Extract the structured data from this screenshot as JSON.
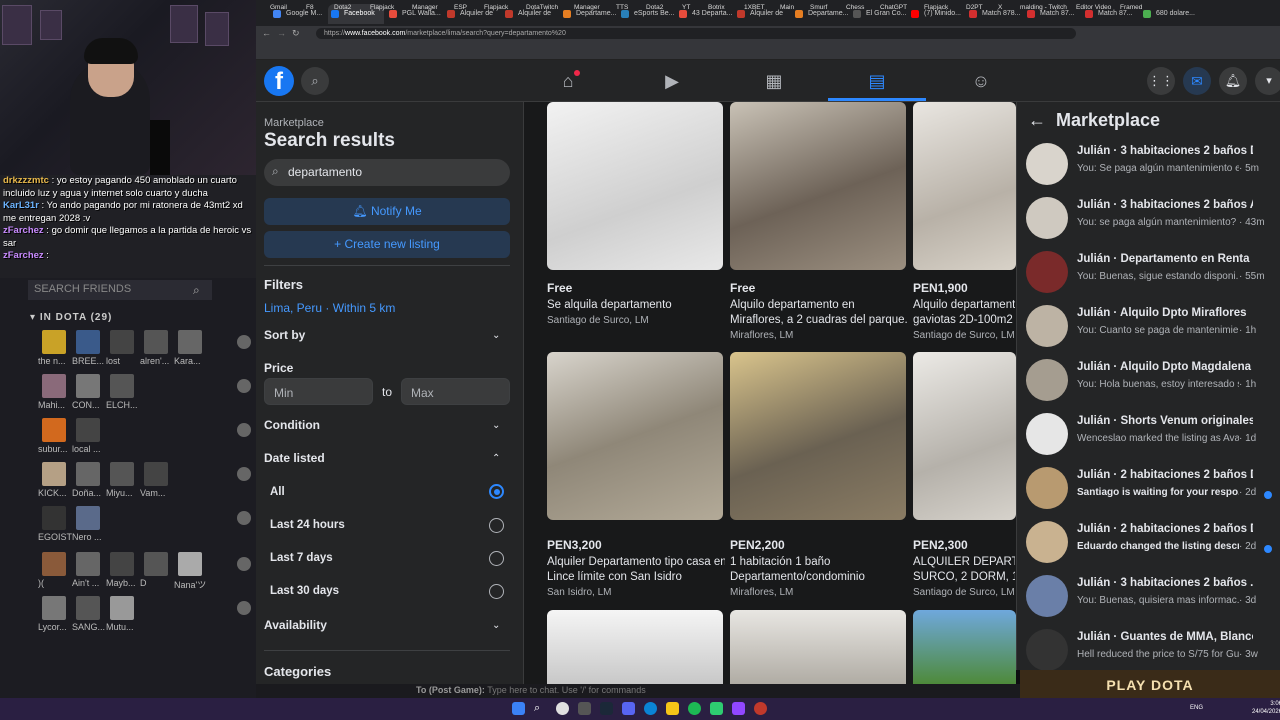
{
  "stream": {
    "chat": [
      {
        "user": "drkzzzmtc",
        "text": " : yo estoy pagando 450 amoblado un cuarto incluido luz y agua y internet solo cuarto y ducha",
        "color": "#e8b84a"
      },
      {
        "user": "KarL31r",
        "text": " : Yo ando pagando por mi ratonera de 43mt2 xd me entregan 2028 :v",
        "color": "#6cb4ff"
      },
      {
        "user": "zFarchez",
        "text": " : go domir que llegamos a la partida de heroic vs sar",
        "color": "#c98bff"
      },
      {
        "user": "zFarchez",
        "text": " : ",
        "color": "#c98bff"
      }
    ],
    "friends_search_placeholder": "SEARCH FRIENDS",
    "group_label": "IN DOTA (29)",
    "friends": [
      "the n...",
      "BREE...",
      "lost",
      "alren'...",
      "Kara...",
      "Mahi...",
      "CON...",
      "ELCH...",
      "subur...",
      "local ...",
      "KICK...",
      "Doña...",
      "Miyu...",
      "Vam...",
      "EGOIST",
      "Nero ...",
      ")(",
      "Ain't ...",
      "Mayb...",
      "D",
      "Nana'ツ",
      "Lycor...",
      "SANG...",
      "Mutu..."
    ],
    "chat_input_prefix": "To (Post Game):",
    "chat_input_placeholder": "Type here to chat. Use '/' for commands"
  },
  "browser": {
    "tabs": [
      "Google M...",
      "Facebook",
      "PGL Walla...",
      "Alquiler de",
      "Alquiler de",
      "Departame...",
      "eSports Be...",
      "43 Departa...",
      "Alquiler de",
      "Departame...",
      "El Gran Co...",
      "(7) Minido...",
      "Match 878...",
      "Match 87...",
      "Match 87...",
      "680 dolare..."
    ],
    "url_prefix": "https://",
    "url_domain": "www.facebook.com",
    "url_path": "/marketplace/lima/search?query=departamento%20",
    "bookmarks": [
      "Gmail",
      "F8",
      "Dota2",
      "Flapjack",
      "Manager",
      "ESP",
      "Flapjack",
      "DotaTwitch",
      "Manager",
      "TTS",
      "Dota2",
      "YT",
      "Botrix",
      "1XBET",
      "Main",
      "Smurf",
      "Chess",
      "ChatGPT",
      "Flapjack",
      "D2PT",
      "X",
      "malding - Twitch",
      "Editor Video",
      "Framed"
    ]
  },
  "marketplace": {
    "breadcrumb": "Marketplace",
    "title": "Search results",
    "search_value": "departamento",
    "notify_label": "Notify Me",
    "create_label": "Create new listing",
    "filters_label": "Filters",
    "location": "Lima, Peru · Within 5 km",
    "sort_label": "Sort by",
    "price_label": "Price",
    "min_placeholder": "Min",
    "to_label": "to",
    "max_placeholder": "Max",
    "condition_label": "Condition",
    "date_label": "Date listed",
    "date_options": [
      "All",
      "Last 24 hours",
      "Last 7 days",
      "Last 30 days"
    ],
    "availability_label": "Availability",
    "categories_label": "Categories",
    "listings": [
      {
        "price": "Free",
        "title": "Se alquila departamento",
        "title2": "",
        "location": "Santiago de Surco, LM"
      },
      {
        "price": "Free",
        "title": "Alquilo departamento en",
        "title2": "Miraflores, a 2 cuadras del parque...",
        "location": "Miraflores, LM"
      },
      {
        "price": "PEN1,900",
        "title": "Alquilo departament",
        "title2": "gaviotas 2D-100m2",
        "location": "Santiago de Surco, LM"
      },
      {
        "price": "PEN3,200",
        "title": "Alquiler Departamento tipo casa en",
        "title2": "Lince límite con San Isidro",
        "location": "San Isidro, LM"
      },
      {
        "price": "PEN2,200",
        "title": "1 habitación 1 baño",
        "title2": "Departamento/condominio",
        "location": "Miraflores, LM"
      },
      {
        "price": "PEN2,300",
        "title": "ALQUILER DEPARTAM",
        "title2": "SURCO, 2 DORM, 1 B",
        "location": "Santiago de Surco, LM"
      }
    ]
  },
  "messenger": {
    "title": "Marketplace",
    "conversations": [
      {
        "title": "Julián · 3 habitaciones 2 baños De...",
        "snippet": "You: Se paga algún mantenimiento e...",
        "time": "· 5m",
        "unread": false
      },
      {
        "title": "Julián · 3 habitaciones 2 baños Ap...",
        "snippet": "You: se paga algún mantenimiento?",
        "time": "· 43m",
        "unread": false
      },
      {
        "title": "Julián · Departamento en Renta su...",
        "snippet": "You: Buenas, sigue estando disponi...",
        "time": "· 55m",
        "unread": false
      },
      {
        "title": "Julián · Alquilo Dpto Miraflores",
        "snippet": "You: Cuanto se paga de mantenimien...",
        "time": "· 1h",
        "unread": false
      },
      {
        "title": "Julián · Alquilo Dpto Magdalena",
        "snippet": "You: Hola buenas, estoy interesado se...",
        "time": "· 1h",
        "unread": false
      },
      {
        "title": "Julián · Shorts Venum originales 2...",
        "snippet": "Wenceslao marked the listing as Avail...",
        "time": "· 1d",
        "unread": false
      },
      {
        "title": "Julián · 2 habitaciones 2 baños D...",
        "snippet": "Santiago is waiting for your respo...",
        "time": "· 2d",
        "unread": true
      },
      {
        "title": "Julián · 2 habitaciones 2 baños D...",
        "snippet": "Eduardo changed the listing descri...",
        "time": "· 2d",
        "unread": true
      },
      {
        "title": "Julián · 3 habitaciones 2 baños ...",
        "snippet": "You: Buenas, quisiera mas informac...",
        "time": "· 3d",
        "unread": false
      },
      {
        "title": "Julián · Guantes de MMA, Blanco y...",
        "snippet": "Hell reduced the price to S/75 for Gu...",
        "time": "· 3w",
        "unread": false
      }
    ]
  },
  "dota_banner": "PLAY DOTA",
  "taskbar": {
    "lang": "ENG",
    "time": "3:06",
    "date": "24/04/2026"
  }
}
